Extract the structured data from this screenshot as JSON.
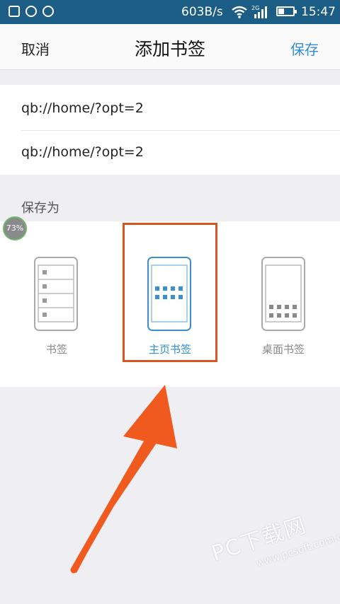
{
  "status_bar": {
    "speed": "603B/s",
    "network": "2G",
    "time": "15:47",
    "icons": [
      "image-icon",
      "app-icon",
      "app-icon",
      "wifi-icon",
      "signal-icon",
      "battery-icon"
    ]
  },
  "header": {
    "cancel_label": "取消",
    "title": "添加书签",
    "save_label": "保存"
  },
  "fields": {
    "title_value": "qb://home/?opt=2",
    "url_value": "qb://home/?opt=2"
  },
  "save_as": {
    "label": "保存为",
    "options": [
      {
        "label": "书签",
        "icon": "bookmark-list-icon",
        "selected": false
      },
      {
        "label": "主页书签",
        "icon": "homepage-grid-icon",
        "selected": true
      },
      {
        "label": "桌面书签",
        "icon": "desktop-grid-icon",
        "selected": false
      }
    ]
  },
  "badge": "73%",
  "watermark": {
    "main": "PC下载网",
    "sub": "www.pcsoft.com.cn"
  },
  "colors": {
    "status_bar": "#1c5d86",
    "accent": "#2f8ed8",
    "highlight": "#d9541e"
  }
}
